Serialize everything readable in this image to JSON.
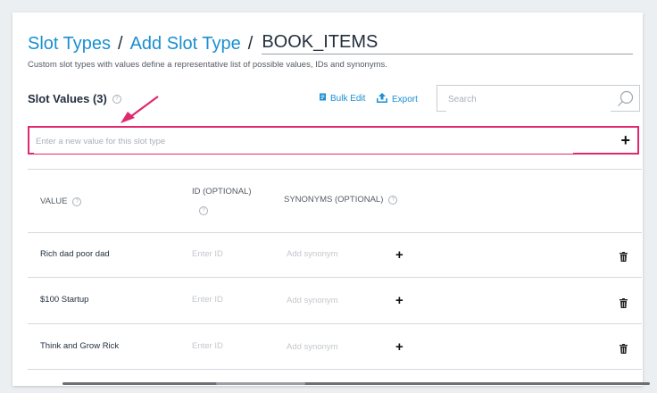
{
  "breadcrumb": {
    "slot_types": "Slot Types",
    "separator": "/",
    "add_slot_type": "Add Slot Type",
    "slot_type_name": "BOOK_ITEMS"
  },
  "subtitle": "Custom slot types with values define a representative list of possible values, IDs and synonyms.",
  "slot_values": {
    "title": "Slot Values (3)",
    "info": "?"
  },
  "toolbar": {
    "bulk_edit": "Bulk Edit",
    "export": "Export",
    "search_placeholder": "Search"
  },
  "new_value": {
    "placeholder": "Enter a new value for this slot type",
    "add": "+"
  },
  "table": {
    "headers": {
      "value": "VALUE",
      "id": "ID (OPTIONAL)",
      "synonyms": "SYNONYMS (OPTIONAL)",
      "info": "?"
    },
    "id_placeholder": "Enter ID",
    "synonym_placeholder": "Add synonym",
    "add": "+",
    "rows": [
      {
        "value": "Rich dad poor dad"
      },
      {
        "value": "$100 Startup"
      },
      {
        "value": "Think and Grow Rick"
      }
    ]
  },
  "colors": {
    "link": "#1a8fd1",
    "highlight": "#e0286f",
    "text": "#232f3e"
  },
  "icons": [
    "bulk-edit-icon",
    "export-icon",
    "search-icon",
    "trash-icon",
    "annotation-arrow"
  ]
}
